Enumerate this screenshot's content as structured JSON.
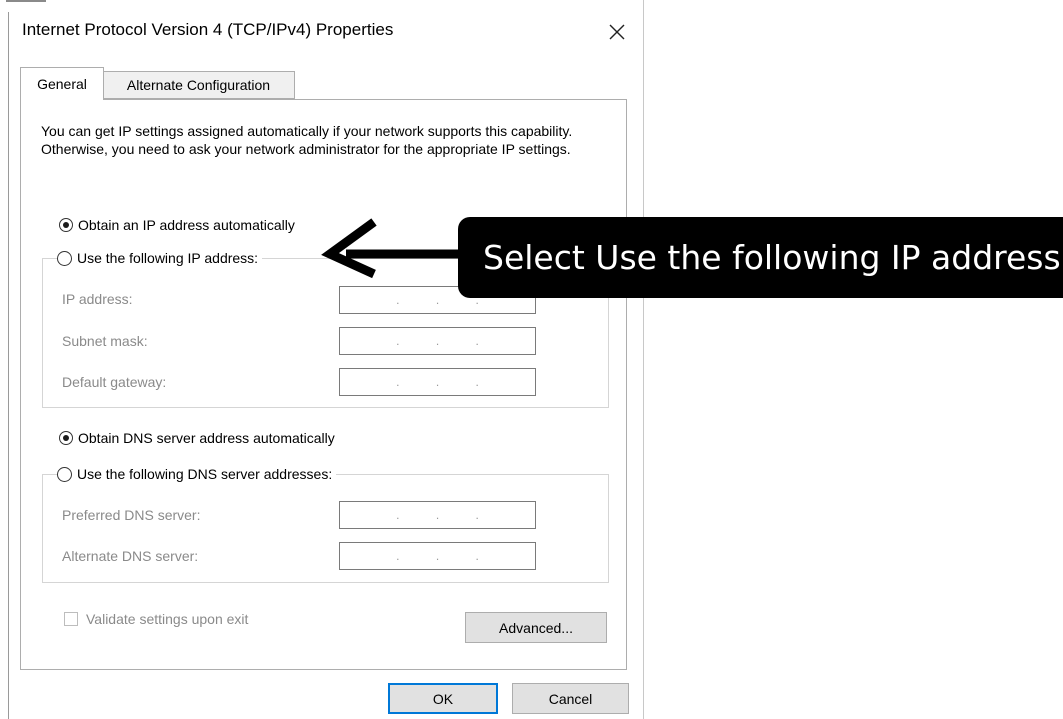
{
  "dialog": {
    "title": "Internet Protocol Version 4 (TCP/IPv4) Properties",
    "tabs": [
      {
        "label": "General",
        "selected": true
      },
      {
        "label": "Alternate Configuration",
        "selected": false
      }
    ],
    "description": "You can get IP settings assigned automatically if your network supports this capability. Otherwise, you need to ask your network administrator for the appropriate IP settings.",
    "ip_section": {
      "auto_label": "Obtain an IP address automatically",
      "auto_selected": true,
      "manual_label": "Use the following IP address:",
      "manual_selected": false,
      "fields": [
        {
          "label": "IP address:",
          "value": ". . ."
        },
        {
          "label": "Subnet mask:",
          "value": ". . ."
        },
        {
          "label": "Default gateway:",
          "value": ". . ."
        }
      ]
    },
    "dns_section": {
      "auto_label": "Obtain DNS server address automatically",
      "auto_selected": true,
      "manual_label": "Use the following DNS server addresses:",
      "manual_selected": false,
      "fields": [
        {
          "label": "Preferred DNS server:",
          "value": ". . ."
        },
        {
          "label": "Alternate DNS server:",
          "value": ". . ."
        }
      ]
    },
    "validate_label": "Validate settings upon exit",
    "validate_checked": false,
    "advanced_label": "Advanced...",
    "ok_label": "OK",
    "cancel_label": "Cancel"
  },
  "annotation": {
    "text": "Select Use the following IP address"
  },
  "colors": {
    "callout_bg": "#000000",
    "callout_text": "#ffffff",
    "default_button_border": "#0078d7",
    "disabled_text": "#8a8a8a"
  },
  "icons": {
    "close": "close-icon",
    "arrow": "arrow-left-icon"
  }
}
